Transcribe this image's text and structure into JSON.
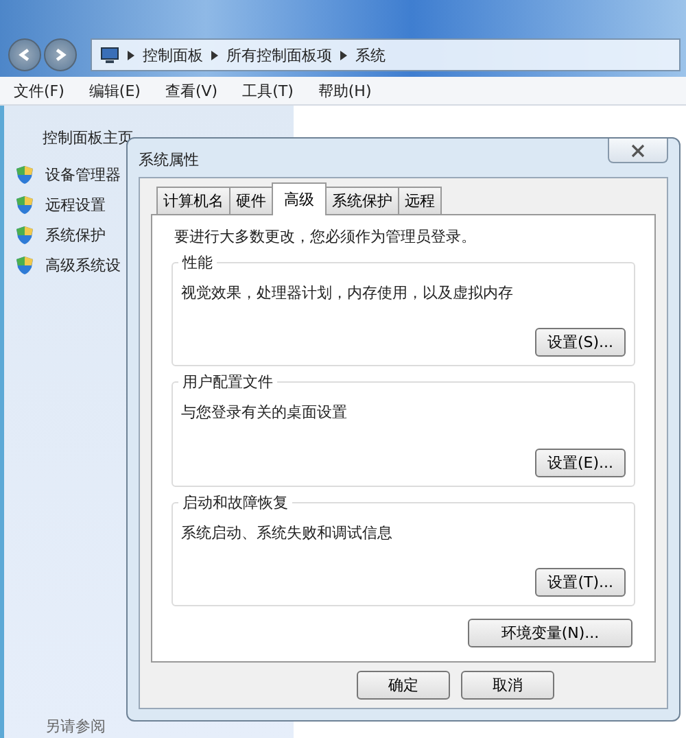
{
  "address_bar": {
    "crumbs": [
      "控制面板",
      "所有控制面板项",
      "系统"
    ]
  },
  "menu_bar": [
    "文件(F)",
    "编辑(E)",
    "查看(V)",
    "工具(T)",
    "帮助(H)"
  ],
  "sidebar": {
    "home": "控制面板主页",
    "items": [
      "设备管理器",
      "远程设置",
      "系统保护",
      "高级系统设"
    ],
    "see_also": "另请参阅"
  },
  "dialog": {
    "title": "系统属性",
    "tabs": [
      {
        "label": "计算机名",
        "selected": false
      },
      {
        "label": "硬件",
        "selected": false
      },
      {
        "label": "高级",
        "selected": true
      },
      {
        "label": "系统保护",
        "selected": false
      },
      {
        "label": "远程",
        "selected": false
      }
    ],
    "notice": "要进行大多数更改，您必须作为管理员登录。",
    "groups": [
      {
        "title": "性能",
        "description": "视觉效果，处理器计划，内存使用，以及虚拟内存",
        "button": "设置(S)..."
      },
      {
        "title": "用户配置文件",
        "description": "与您登录有关的桌面设置",
        "button": "设置(E)..."
      },
      {
        "title": "启动和故障恢复",
        "description": "系统启动、系统失败和调试信息",
        "button": "设置(T)..."
      }
    ],
    "env_button": "环境变量(N)...",
    "buttons": [
      "确定",
      "取消"
    ]
  }
}
